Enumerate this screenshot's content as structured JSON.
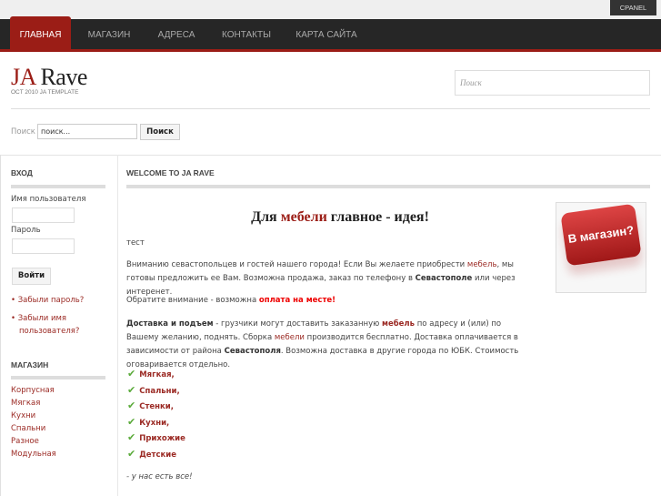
{
  "topbar": {
    "cpanel": "CPANEL"
  },
  "nav": {
    "items": [
      {
        "label": "ГЛАВНАЯ",
        "active": true
      },
      {
        "label": "МАГАЗИН"
      },
      {
        "label": "АДРЕСА"
      },
      {
        "label": "КОНТАКТЫ"
      },
      {
        "label": "КАРТА САЙТА"
      }
    ]
  },
  "header": {
    "logo_ja": "JA",
    "logo_rave": "Rave",
    "tagline": "OCT 2010 JA TEMPLATE",
    "search_placeholder": "Поиск"
  },
  "search": {
    "label": "Поиск",
    "value": "поиск...",
    "button": "Поиск"
  },
  "login": {
    "title": "ВХОД",
    "username_label": "Имя пользователя",
    "password_label": "Пароль",
    "submit": "Войти",
    "links": [
      "Забыли пароль?",
      "Забыли имя пользователя?"
    ]
  },
  "shop": {
    "title": "МАГАЗИН",
    "items": [
      "Корпусная",
      "Мягкая",
      "Кухни",
      "Спальни",
      "Разное",
      "Модульная"
    ]
  },
  "main": {
    "heading": "WELCOME TO JA RAVE",
    "title_a": "Для ",
    "title_red": "мебели",
    "title_b": " главное - идея!",
    "test": "тест",
    "p1a": "Вниманию севастопольцев и гостей нашего города! Если Вы желаете приобрести ",
    "p1link": "мебель",
    "p1b": ", мы готовы предложить ее Вам. Возможна продажа, заказ по телефону в ",
    "p1bold": "Севастополе",
    "p1c": " или через интеренет.",
    "p2a": "Обратите внимание - возможна ",
    "p2red": "оплата на месте!",
    "p3bold": "Доставка и подъем",
    "p3a": "  - грузчики могут доставить заказанную  ",
    "p3link1": "мебель",
    "p3b": " по адресу и (или) по Вашему желанию, поднять. Сборка  ",
    "p3link2": "мебели",
    "p3c": " производится бесплатно. Доставка оплачивается в зависимости от района ",
    "p3bold2": "Севастополя",
    "p3d": ". Возможна доставка в другие города по ЮБК. Стоимость оговаривается отдельно.",
    "checklist": [
      "Мягкая,",
      "Спальни,",
      "Стенки,",
      "Кухни,",
      "Прихожие",
      "Детские"
    ],
    "footer_note": "- у нас есть все!",
    "promo": "В магазин?"
  },
  "colors": {
    "accent": "#9b1d16",
    "nav_bg": "#262626",
    "check": "#5aaa3a"
  }
}
